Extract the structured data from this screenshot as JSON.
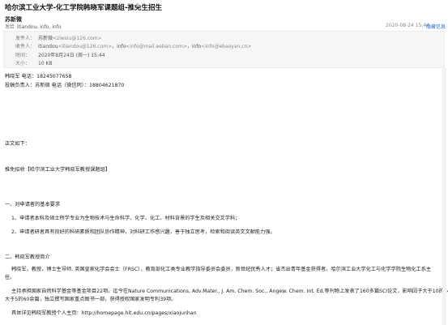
{
  "header": {
    "subject": "哈尔滨工业大学-化工学院韩晓军课题组-推免生招生",
    "star_icon": "star-icon"
  },
  "sender": {
    "name": "苏新微",
    "to_label": "发给",
    "to_value": "itiandou, info, info",
    "timestamp": "2020-08-24 15:44",
    "collapse": "隐藏信息"
  },
  "details": {
    "from_label": "发件人：",
    "from_name": "苏新微",
    "from_email": "<ziwsiu@126.com>",
    "to_label": "收件人：",
    "to1_name": "itiandou",
    "to1_email": "<itiandou@126.com>",
    "to2_name": "info",
    "to2_email": "<info@mail.eeban.com>",
    "to3_name": "info",
    "to3_email": "<info@ebaoyan.cn>",
    "sep": "，",
    "time_label": "时间：",
    "time_value": "2020年8月24日 (周一) 15:44",
    "size_label": "大小：",
    "size_value": "10 KB"
  },
  "body": {
    "l1": "韩晓军  电话：18245077658",
    "l2": "投稿负责人：苏新微 电话（微信同）：18804621870",
    "l3": "正文如下：",
    "l4": "推免招收【哈尔滨工业大学韩晓军教授课题组】",
    "l5": "一、对申请者的基本要求",
    "l6": "1、申请者本科及硕士所学专业为生物技术与生命科学、化学、化工、材料背景的学生及相关交叉学科；",
    "l7": "2、申请者研者具有良好的科研素质和团队协作精神，对科研工作感兴趣，善于独立思考，检索和阅读英文文献能力强。",
    "l8": "二、韩晓军教授简介",
    "l9a": "韩晓军，教授，博士生导师. 英国皇家化学会会士（FRSC），教育部化工类专业教学指导委员会委员，新世纪优秀人才；省杰出青年基金获得者。哈尔滨工业大学化工与化学学院生物化工系主",
    "l9b": "任。",
    "l10a": "主持承担国家自然科学基金等基金项目22项。迄今在Nature Communications, Adv.Mater., J. Am. Chem. Soc., Angew. Chem. Int. Ed.等刊物上发表了160多篇SCI论文，影响因子大于10的24篇，",
    "l10b": "大于5的60余篇，独立撰写国家重点图书一部，获得授权国家发明专利39项。",
    "l11": "具体详见韩晓军教授个人主页：http://homepage.hit.edu.cn/pages/xiaojunhan"
  }
}
